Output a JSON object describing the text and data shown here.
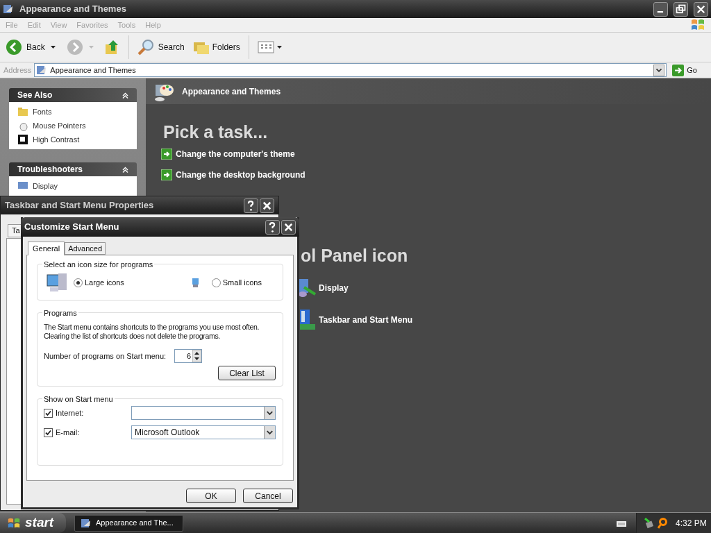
{
  "explorer": {
    "title": "Appearance and Themes",
    "menu": [
      "File",
      "Edit",
      "View",
      "Favorites",
      "Tools",
      "Help"
    ],
    "toolbar": {
      "back": "Back",
      "search": "Search",
      "folders": "Folders"
    },
    "address": {
      "label": "Address",
      "value": "Appearance and Themes",
      "go": "Go"
    },
    "see_also": {
      "title": "See Also",
      "items": [
        {
          "label": "Fonts",
          "kind": "fonts"
        },
        {
          "label": "Mouse Pointers",
          "kind": "mouse"
        },
        {
          "label": "High Contrast",
          "kind": "contrast"
        }
      ]
    },
    "troubleshooters": {
      "title": "Troubleshooters",
      "items": [
        {
          "label": "Display"
        }
      ]
    },
    "header": "Appearance and Themes",
    "task_heading": "Pick a task...",
    "tasks": [
      "Change the computer's theme",
      "Change the desktop background"
    ],
    "icon_heading": "ol Panel icon",
    "icons": [
      {
        "label": "Display",
        "kind": "display"
      },
      {
        "label": "Taskbar and Start Menu",
        "kind": "taskbar"
      }
    ]
  },
  "properties_dialog": {
    "title": "Taskbar and Start Menu Properties",
    "tab": "Ta"
  },
  "customize_dialog": {
    "title": "Customize Start Menu",
    "tabs": [
      {
        "label": "General",
        "selected": true
      },
      {
        "label": "Advanced",
        "selected": false
      }
    ],
    "icon_size": {
      "title": "Select an icon size for programs",
      "options": [
        {
          "label": "Large icons",
          "kind": "large",
          "selected": true
        },
        {
          "label": "Small icons",
          "kind": "small",
          "selected": false
        }
      ]
    },
    "programs": {
      "title": "Programs",
      "description": "The Start menu contains shortcuts to the programs you use most often.\nClearing the list of shortcuts does not delete the programs.",
      "count_label": "Number of programs on Start menu:",
      "count": "6",
      "clear_button": "Clear List"
    },
    "show": {
      "title": "Show on Start menu",
      "items": [
        {
          "label": "Internet:",
          "checked": true
        },
        {
          "label": "E-mail:",
          "checked": true,
          "value": "Microsoft Outlook"
        }
      ]
    },
    "buttons": [
      "OK",
      "Cancel"
    ]
  },
  "taskbar": {
    "start": "start",
    "tasks": [
      "Appearance and The..."
    ],
    "clock": "4:32 PM"
  }
}
